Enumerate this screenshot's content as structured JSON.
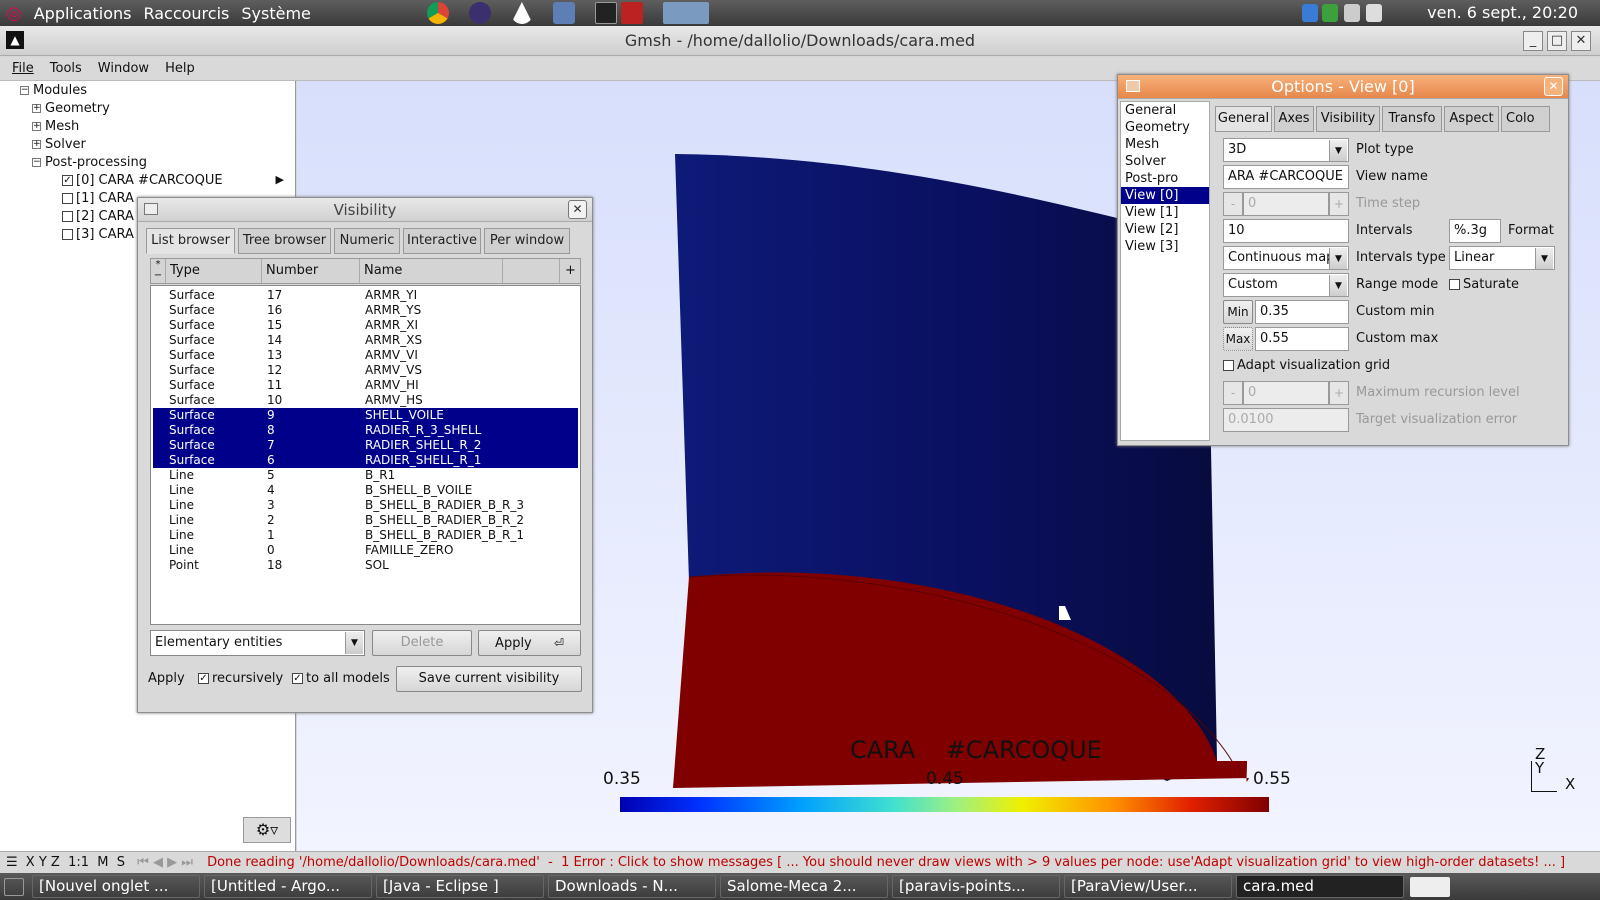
{
  "system_panel": {
    "menus": [
      "Applications",
      "Raccourcis",
      "Système"
    ],
    "clock": "ven.  6 sept., 20:20"
  },
  "window": {
    "title": "Gmsh - /home/dallolio/Downloads/cara.med"
  },
  "menubar": [
    "File",
    "Tools",
    "Window",
    "Help"
  ],
  "tree": {
    "root": "Modules",
    "items": [
      "Geometry",
      "Mesh",
      "Solver",
      "Post-processing"
    ],
    "views": [
      {
        "label": "[0] CARA    #CARCOQUE",
        "checked": true
      },
      {
        "label": "[1] CARA",
        "checked": false
      },
      {
        "label": "[2] CARA",
        "checked": false
      },
      {
        "label": "[3] CARA",
        "checked": false
      }
    ]
  },
  "visibility": {
    "title": "Visibility",
    "tabs": [
      "List browser",
      "Tree browser",
      "Numeric",
      "Interactive",
      "Per window"
    ],
    "columns": [
      "Type",
      "Number",
      "Name"
    ],
    "rows": [
      {
        "type": "Surface",
        "number": "17",
        "name": "ARMR_YI",
        "selected": false
      },
      {
        "type": "Surface",
        "number": "16",
        "name": "ARMR_YS",
        "selected": false
      },
      {
        "type": "Surface",
        "number": "15",
        "name": "ARMR_XI",
        "selected": false
      },
      {
        "type": "Surface",
        "number": "14",
        "name": "ARMR_XS",
        "selected": false
      },
      {
        "type": "Surface",
        "number": "13",
        "name": "ARMV_VI",
        "selected": false
      },
      {
        "type": "Surface",
        "number": "12",
        "name": "ARMV_VS",
        "selected": false
      },
      {
        "type": "Surface",
        "number": "11",
        "name": "ARMV_HI",
        "selected": false
      },
      {
        "type": "Surface",
        "number": "10",
        "name": "ARMV_HS",
        "selected": false
      },
      {
        "type": "Surface",
        "number": "9",
        "name": "SHELL_VOILE",
        "selected": true
      },
      {
        "type": "Surface",
        "number": "8",
        "name": "RADIER_R_3_SHELL",
        "selected": true
      },
      {
        "type": "Surface",
        "number": "7",
        "name": "RADIER_SHELL_R_2",
        "selected": true
      },
      {
        "type": "Surface",
        "number": "6",
        "name": "RADIER_SHELL_R_1",
        "selected": true
      },
      {
        "type": "Line",
        "number": "5",
        "name": "B_R1",
        "selected": false
      },
      {
        "type": "Line",
        "number": "4",
        "name": "B_SHELL_B_VOILE",
        "selected": false
      },
      {
        "type": "Line",
        "number": "3",
        "name": "B_SHELL_B_RADIER_B_R_3",
        "selected": false
      },
      {
        "type": "Line",
        "number": "2",
        "name": "B_SHELL_B_RADIER_B_R_2",
        "selected": false
      },
      {
        "type": "Line",
        "number": "1",
        "name": "B_SHELL_B_RADIER_B_R_1",
        "selected": false
      },
      {
        "type": "Line",
        "number": "0",
        "name": "FAMILLE_ZERO",
        "selected": false
      },
      {
        "type": "Point",
        "number": "18",
        "name": "SOL",
        "selected": false
      }
    ],
    "mode_select": "Elementary entities",
    "delete_label": "Delete",
    "apply_label": "Apply",
    "apply_text": "Apply",
    "recursively_label": "recursively",
    "to_all_models_label": "to all models",
    "save_label": "Save current visibility"
  },
  "options": {
    "title": "Options - View [0]",
    "nav": [
      "General",
      "Geometry",
      "Mesh",
      "Solver",
      "Post-pro",
      "View [0]",
      "View [1]",
      "View [2]",
      "View [3]"
    ],
    "tabs": [
      "General",
      "Axes",
      "Visibility",
      "Transfo",
      "Aspect",
      "Colo"
    ],
    "plot_type": "3D",
    "plot_type_label": "Plot type",
    "view_name": "ARA    #CARCOQUE",
    "view_name_label": "View name",
    "time_step": "0",
    "time_step_label": "Time step",
    "intervals": "10",
    "intervals_label": "Intervals",
    "format": "%.3g",
    "format_label": "Format",
    "intervals_type_mode": "Continuous map",
    "intervals_type_label": "Intervals type",
    "intervals_type": "Linear",
    "range_mode": "Custom",
    "range_mode_label": "Range mode",
    "saturate_label": "Saturate",
    "min_btn": "Min",
    "min_value": "0.35",
    "custom_min_label": "Custom min",
    "max_btn": "Max",
    "max_value": "0.55",
    "custom_max_label": "Custom max",
    "adapt_label": "Adapt visualization grid",
    "max_recursion": "0",
    "max_recursion_label": "Maximum recursion level",
    "target_error": "0.0100",
    "target_error_label": "Target visualization error"
  },
  "viewport": {
    "view_label": "CARA    #CARCOQUE",
    "scale_min": "0.35",
    "scale_mid": "0.45",
    "scale_max": "0.55",
    "axis_z": "Z",
    "axis_y": "Y",
    "axis_x": "X"
  },
  "statusbar": {
    "controls": "X Y Z  1:1  M  S",
    "message": "Done reading '/home/dallolio/Downloads/cara.med'  -  1 Error : Click to show messages [ ... You should never draw views with > 9 values per node: use'Adapt visualization grid' to view high-order datasets! ... ]"
  },
  "taskbar": [
    "[Nouvel onglet ...",
    "[Untitled - Argo...",
    "[Java - Eclipse ]",
    "Downloads - N...",
    "Salome-Meca 2...",
    "[paravis-points...",
    "[ParaView/User...",
    "cara.med"
  ]
}
